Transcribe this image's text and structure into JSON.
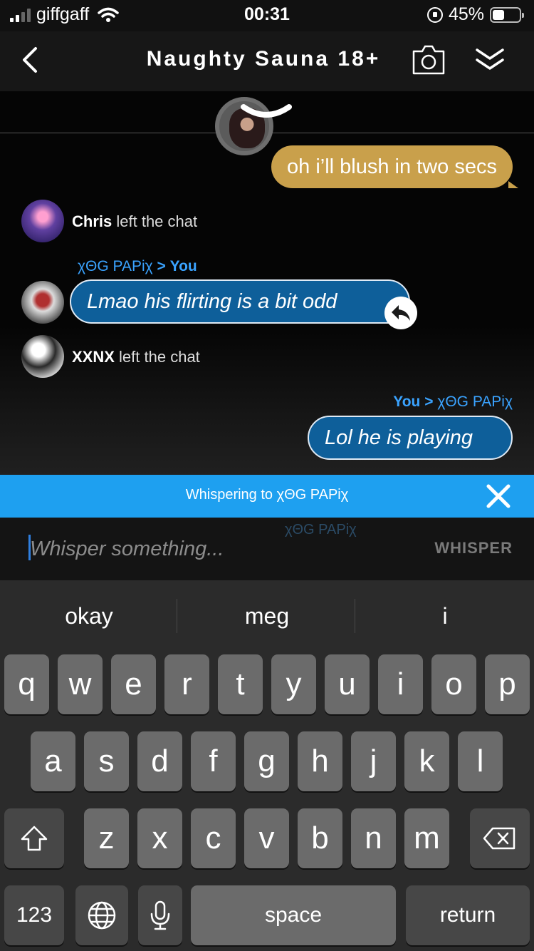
{
  "status_bar": {
    "carrier": "giffgaff",
    "time": "00:31",
    "battery_percent": "45%",
    "battery_level": 0.45
  },
  "header": {
    "title": "Naughty Sauna 18+",
    "icons": [
      "chevron-left-icon",
      "camera-icon",
      "double-chevron-down-icon"
    ]
  },
  "messages": [
    {
      "type": "bubble",
      "side": "right",
      "color": "#c9a04b",
      "text": "oh i’ll blush in two secs"
    },
    {
      "type": "system",
      "user": "Chris",
      "text": "left the chat"
    },
    {
      "type": "whisper",
      "side": "left",
      "from": "χΘG PAPiχ",
      "arrow": ">",
      "to": "You",
      "text": "Lmao his flirting is a bit odd"
    },
    {
      "type": "system",
      "user": "XXNX",
      "text": "left the chat"
    },
    {
      "type": "whisper",
      "side": "right",
      "from": "You",
      "arrow": ">",
      "to": "χΘG PAPiχ",
      "text": "Lol he is playing"
    }
  ],
  "whisper_banner": {
    "text": "Whispering to χΘG PAPiχ",
    "color": "#1ea0f0"
  },
  "input": {
    "placeholder": "Whisper something...",
    "value": "",
    "send_label": "WHISPER",
    "background_text": "χΘG PAPiχ"
  },
  "keyboard": {
    "suggestions": [
      "okay",
      "meg",
      "i"
    ],
    "row1": [
      "q",
      "w",
      "e",
      "r",
      "t",
      "y",
      "u",
      "i",
      "o",
      "p"
    ],
    "row2": [
      "a",
      "s",
      "d",
      "f",
      "g",
      "h",
      "j",
      "k",
      "l"
    ],
    "row3": [
      "z",
      "x",
      "c",
      "v",
      "b",
      "n",
      "m"
    ],
    "numbers_label": "123",
    "space_label": "space",
    "return_label": "return"
  },
  "colors": {
    "whisper_bubble": "#0e5f9a",
    "whisper_label": "#3aa3ff",
    "own_bubble": "#c9a04b"
  }
}
